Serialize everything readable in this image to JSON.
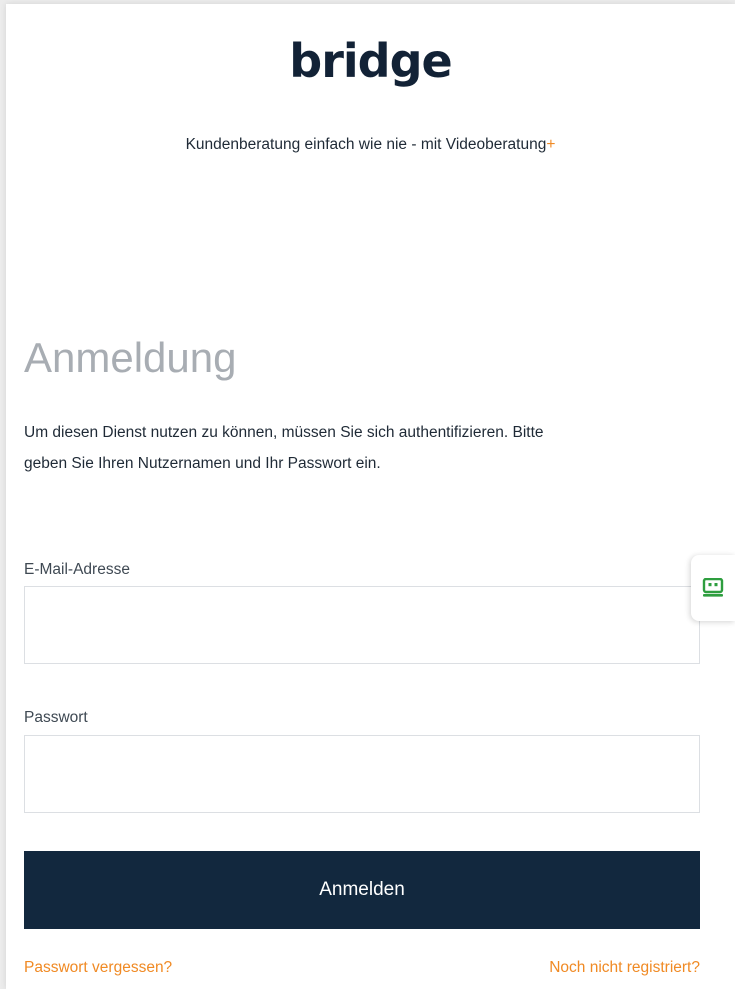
{
  "brand": {
    "logo_text": "bridge",
    "tagline": "Kundenberatung einfach wie nie - mit Videoberatung",
    "tagline_plus": "+"
  },
  "login": {
    "title": "Anmeldung",
    "intro": "Um diesen Dienst nutzen zu können, müssen Sie sich authentifizieren. Bitte geben Sie Ihren Nutzernamen und Ihr Passwort ein.",
    "email_label": "E-Mail-Adresse",
    "email_value": "",
    "password_label": "Passwort",
    "password_value": "",
    "submit_label": "Anmelden",
    "forgot_password_link": "Passwort vergessen?",
    "register_link": "Noch nicht registriert?"
  },
  "side_widget": {
    "icon": "chat-bot-icon"
  },
  "colors": {
    "brand_dark": "#12283e",
    "accent_orange": "#f08a24",
    "widget_green": "#2e9e3f",
    "title_gray": "#a8adb3"
  }
}
